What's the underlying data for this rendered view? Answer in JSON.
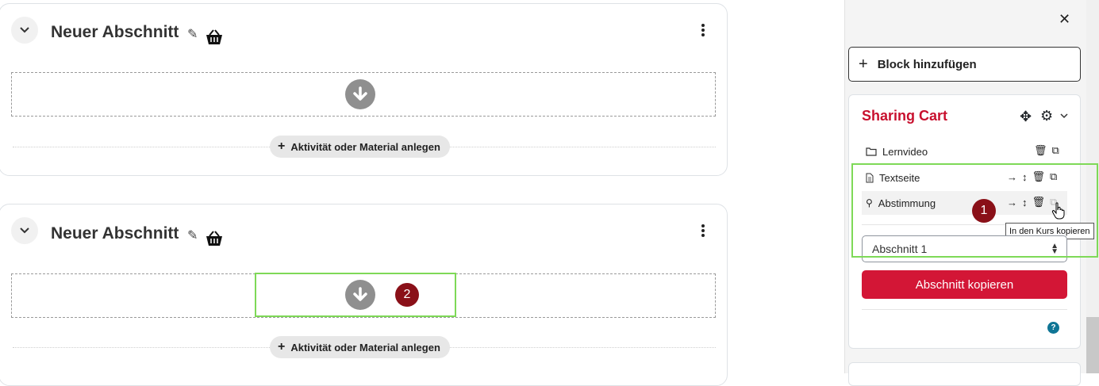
{
  "sections": [
    {
      "title": "Neuer Abschnitt",
      "add_activity_label": "Aktivität oder Material anlegen"
    },
    {
      "title": "Neuer Abschnitt",
      "add_activity_label": "Aktivität oder Material anlegen"
    }
  ],
  "drawer": {
    "add_block_label": "Block hinzufügen",
    "cart": {
      "title": "Sharing Cart",
      "items": [
        {
          "label": "Lernvideo",
          "icon": "folder-icon"
        },
        {
          "label": "Textseite",
          "icon": "page-icon"
        },
        {
          "label": "Abstimmung",
          "icon": "poll-icon"
        }
      ],
      "section_select": {
        "selected": "Abschnitt 1"
      },
      "copy_section_label": "Abschnitt kopieren",
      "tooltip": "In den Kurs kopieren",
      "help": "?"
    }
  },
  "annotations": {
    "marker1": "1",
    "marker2": "2"
  },
  "colors": {
    "cart_title": "#c8102e",
    "copy_button": "#d31636",
    "highlight_box": "#7ed957",
    "marker": "#8a1018"
  }
}
